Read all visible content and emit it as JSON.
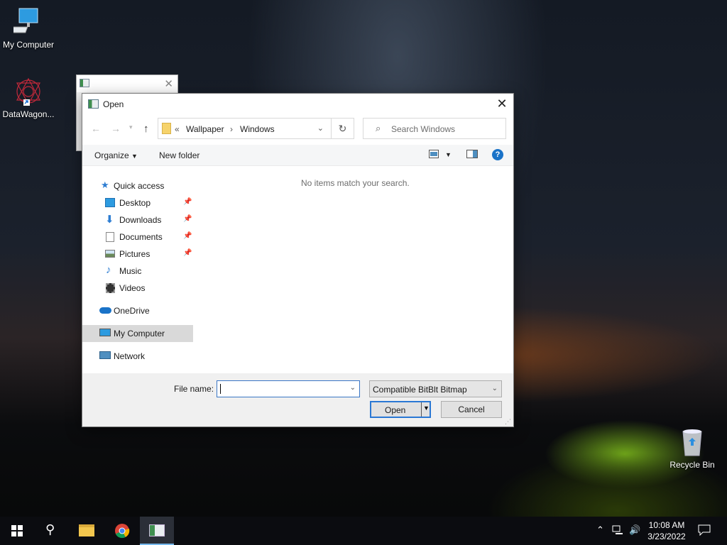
{
  "desktop": {
    "icons": [
      {
        "label": "My Computer",
        "icon": "monitor-icon"
      },
      {
        "label": "DataWagon...",
        "icon": "datawagon-icon"
      },
      {
        "label": "Recycle Bin",
        "icon": "recycle-bin-icon"
      }
    ]
  },
  "dialog": {
    "title": "Open",
    "breadcrumb": {
      "prefix": "«",
      "items": [
        "Wallpaper",
        "Windows"
      ]
    },
    "search_placeholder": "Search Windows",
    "toolbar": {
      "organize": "Organize",
      "new_folder": "New folder"
    },
    "nav_items": [
      {
        "label": "Quick access",
        "icon": "star-icon",
        "pinned": false
      },
      {
        "label": "Desktop",
        "icon": "desktop-folder-icon",
        "pinned": true
      },
      {
        "label": "Downloads",
        "icon": "download-arrow-icon",
        "pinned": true
      },
      {
        "label": "Documents",
        "icon": "document-icon",
        "pinned": true
      },
      {
        "label": "Pictures",
        "icon": "pictures-icon",
        "pinned": true
      },
      {
        "label": "Music",
        "icon": "music-note-icon",
        "pinned": false
      },
      {
        "label": "Videos",
        "icon": "film-icon",
        "pinned": false
      },
      {
        "label": "OneDrive",
        "icon": "cloud-icon",
        "pinned": false
      },
      {
        "label": "My Computer",
        "icon": "monitor-icon",
        "pinned": false,
        "selected": true
      },
      {
        "label": "Network",
        "icon": "network-icon",
        "pinned": false
      }
    ],
    "empty_message": "No items match your search.",
    "file_name_label": "File name:",
    "file_name_value": "",
    "file_type": "Compatible BitBlt Bitmap",
    "open_label": "Open",
    "cancel_label": "Cancel"
  },
  "taskbar": {
    "time": "10:08 AM",
    "date": "3/23/2022"
  },
  "colors": {
    "accent": "#2a78d4",
    "taskbar": "#0b0c10",
    "selection": "#d9d9d9"
  }
}
